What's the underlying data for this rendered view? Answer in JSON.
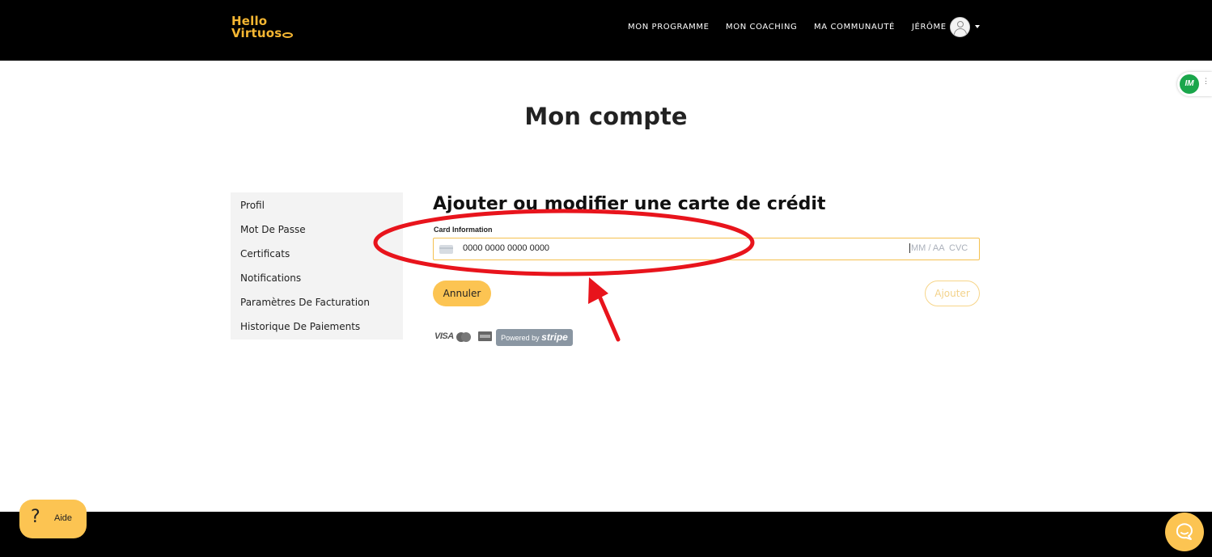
{
  "header": {
    "logo_line1": "Hello",
    "logo_line2": "Virtuos",
    "nav": [
      "MON PROGRAMME",
      "MON COACHING",
      "MA COMMUNAUTÉ"
    ],
    "user_name": "JÉRÔME"
  },
  "extension_badge": {
    "label": "IM"
  },
  "page_title": "Mon compte",
  "sidebar": {
    "items": [
      {
        "label": "Profil"
      },
      {
        "label": "Mot De Passe"
      },
      {
        "label": "Certificats"
      },
      {
        "label": "Notifications"
      },
      {
        "label": "Paramètres De Facturation"
      },
      {
        "label": "Historique De Paiements"
      }
    ]
  },
  "card_form": {
    "title": "Ajouter ou modifier une carte de crédit",
    "label": "Card Information",
    "number_value": "0000 0000 0000 0000",
    "expiry_placeholder": "MM / AA",
    "cvc_placeholder": "CVC",
    "cancel_label": "Annuler",
    "add_label": "Ajouter",
    "brands": {
      "visa": "VISA"
    },
    "powered_by": "Powered by",
    "stripe": "stripe"
  },
  "help": {
    "label": "Aide",
    "glyph": "?"
  },
  "colors": {
    "accent": "#fcc452",
    "logo": "#f5b632",
    "annotation": "#e8141c",
    "header_bg": "#000000"
  }
}
